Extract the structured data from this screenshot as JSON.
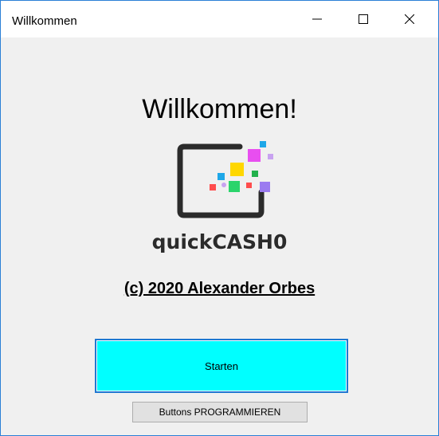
{
  "window": {
    "title": "Willkommen",
    "border_color": "#2a7fd6"
  },
  "titlebar_buttons": {
    "minimize_icon": "minimize-icon",
    "maximize_icon": "maximize-icon",
    "close_icon": "close-icon"
  },
  "main": {
    "heading": "Willkommen!",
    "brand_name": "quickCASH0",
    "copyright": "(c) 2020 Alexander Orbes"
  },
  "buttons": {
    "start_label": "Starten",
    "start_color": "#00ffff",
    "program_label": "Buttons PROGRAMMIEREN"
  },
  "logo": {
    "icon": "quickcash-logo-icon",
    "frame_color": "#2b2b2b",
    "square_colors": [
      "#ffd700",
      "#e84ef0",
      "#22b14c",
      "#9b7bf0",
      "#1ea7e8",
      "#ff4d4d",
      "#c8a2f0",
      "#2bd46b"
    ]
  }
}
